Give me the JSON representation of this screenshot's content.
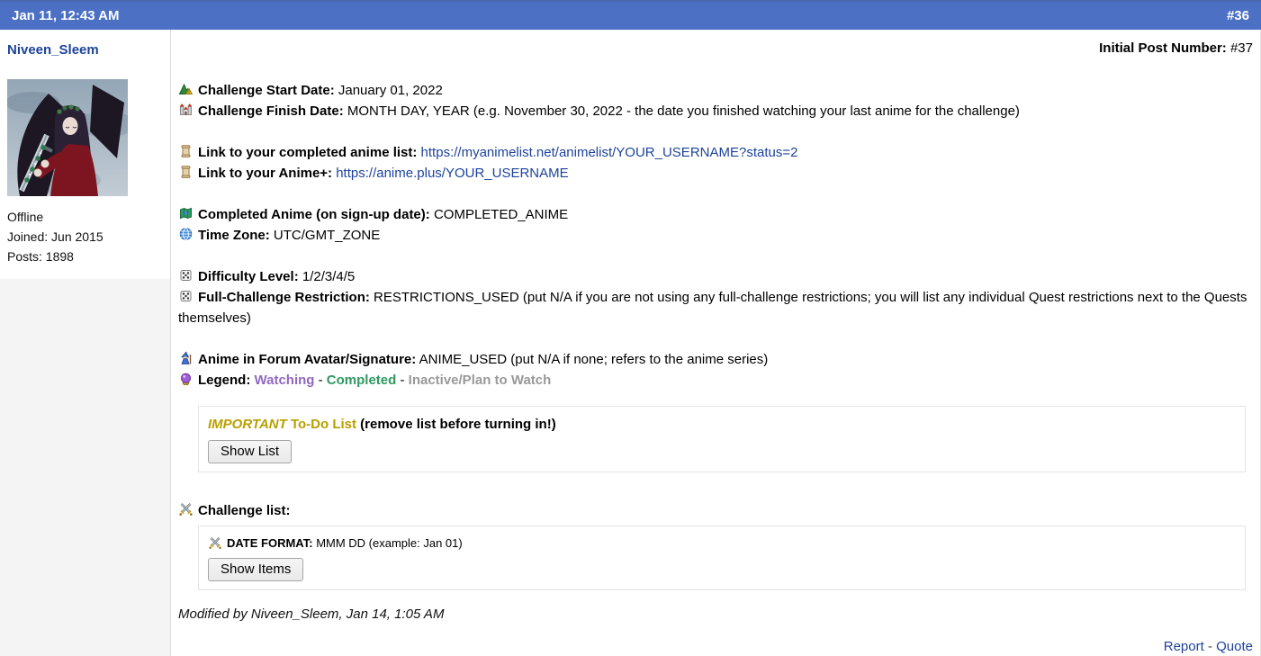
{
  "colors": {
    "header_bg": "#4c70c4",
    "link": "#1d439b",
    "username": "#1d439b",
    "gold": "#b8a000",
    "watching": "#9068c1",
    "completed": "#2e9960",
    "inactive": "#999999"
  },
  "header": {
    "date": "Jan 11, 12:43 AM",
    "post_number": "#36"
  },
  "user": {
    "name": "Niveen_Sleem",
    "status": "Offline",
    "joined": "Joined: Jun 2015",
    "posts": "Posts: 1898",
    "avatar_icon": "user-avatar-image"
  },
  "post": {
    "initial_post_label": "Initial Post Number:",
    "initial_post_value": "#37",
    "start": {
      "icon": "camping-icon",
      "label": "Challenge Start Date:",
      "value": "January 01, 2022"
    },
    "finish": {
      "icon": "castle-icon",
      "label": "Challenge Finish Date:",
      "value": "MONTH DAY, YEAR (e.g. November 30, 2022 - the date you finished watching your last anime for the challenge)"
    },
    "anime_list_link": {
      "icon": "scroll-icon",
      "label": "Link to your completed anime list:",
      "url": "https://myanimelist.net/animelist/YOUR_USERNAME?status=2"
    },
    "anime_plus_link": {
      "icon": "scroll-icon",
      "label": "Link to your Anime+:",
      "url": "https://anime.plus/YOUR_USERNAME"
    },
    "completed_anime": {
      "icon": "map-icon",
      "label": "Completed Anime (on sign-up date):",
      "value": "COMPLETED_ANIME"
    },
    "time_zone": {
      "icon": "globe-icon",
      "label": "Time Zone:",
      "value": "UTC/GMT_ZONE"
    },
    "difficulty": {
      "icon": "dice-icon",
      "label": "Difficulty Level:",
      "value": "1/2/3/4/5"
    },
    "restriction": {
      "icon": "dice-icon",
      "label": "Full-Challenge Restriction:",
      "value": "RESTRICTIONS_USED (put N/A if you are not using any full-challenge restrictions; you will list any individual Quest restrictions next to the Quests themselves)"
    },
    "avatar_signature": {
      "icon": "wizard-icon",
      "label": "Anime in Forum Avatar/Signature:",
      "value": "ANIME_USED (put N/A if none; refers to the anime series)"
    },
    "legend": {
      "icon": "crystal-ball-icon",
      "label": "Legend:",
      "separator": " - ",
      "items": [
        {
          "text": "Watching",
          "color": "#9068c1"
        },
        {
          "text": "Completed",
          "color": "#2e9960"
        },
        {
          "text": "Inactive/Plan to Watch",
          "color": "#999999"
        }
      ]
    },
    "todo_box": {
      "important": "IMPORTANT",
      "title": "To-Do List",
      "note": "(remove list before turning in!)",
      "button_label": "Show List"
    },
    "challenge_list": {
      "icon": "crossed-swords-icon",
      "label": "Challenge list:"
    },
    "date_format_box": {
      "icon": "crossed-swords-icon",
      "label": "DATE FORMAT:",
      "value": "MMM DD (example: Jan 01)",
      "button_label": "Show Items"
    },
    "modified": "Modified by Niveen_Sleem, Jan 14, 1:05 AM",
    "footer": {
      "report": "Report",
      "separator": " - ",
      "quote": "Quote"
    }
  }
}
